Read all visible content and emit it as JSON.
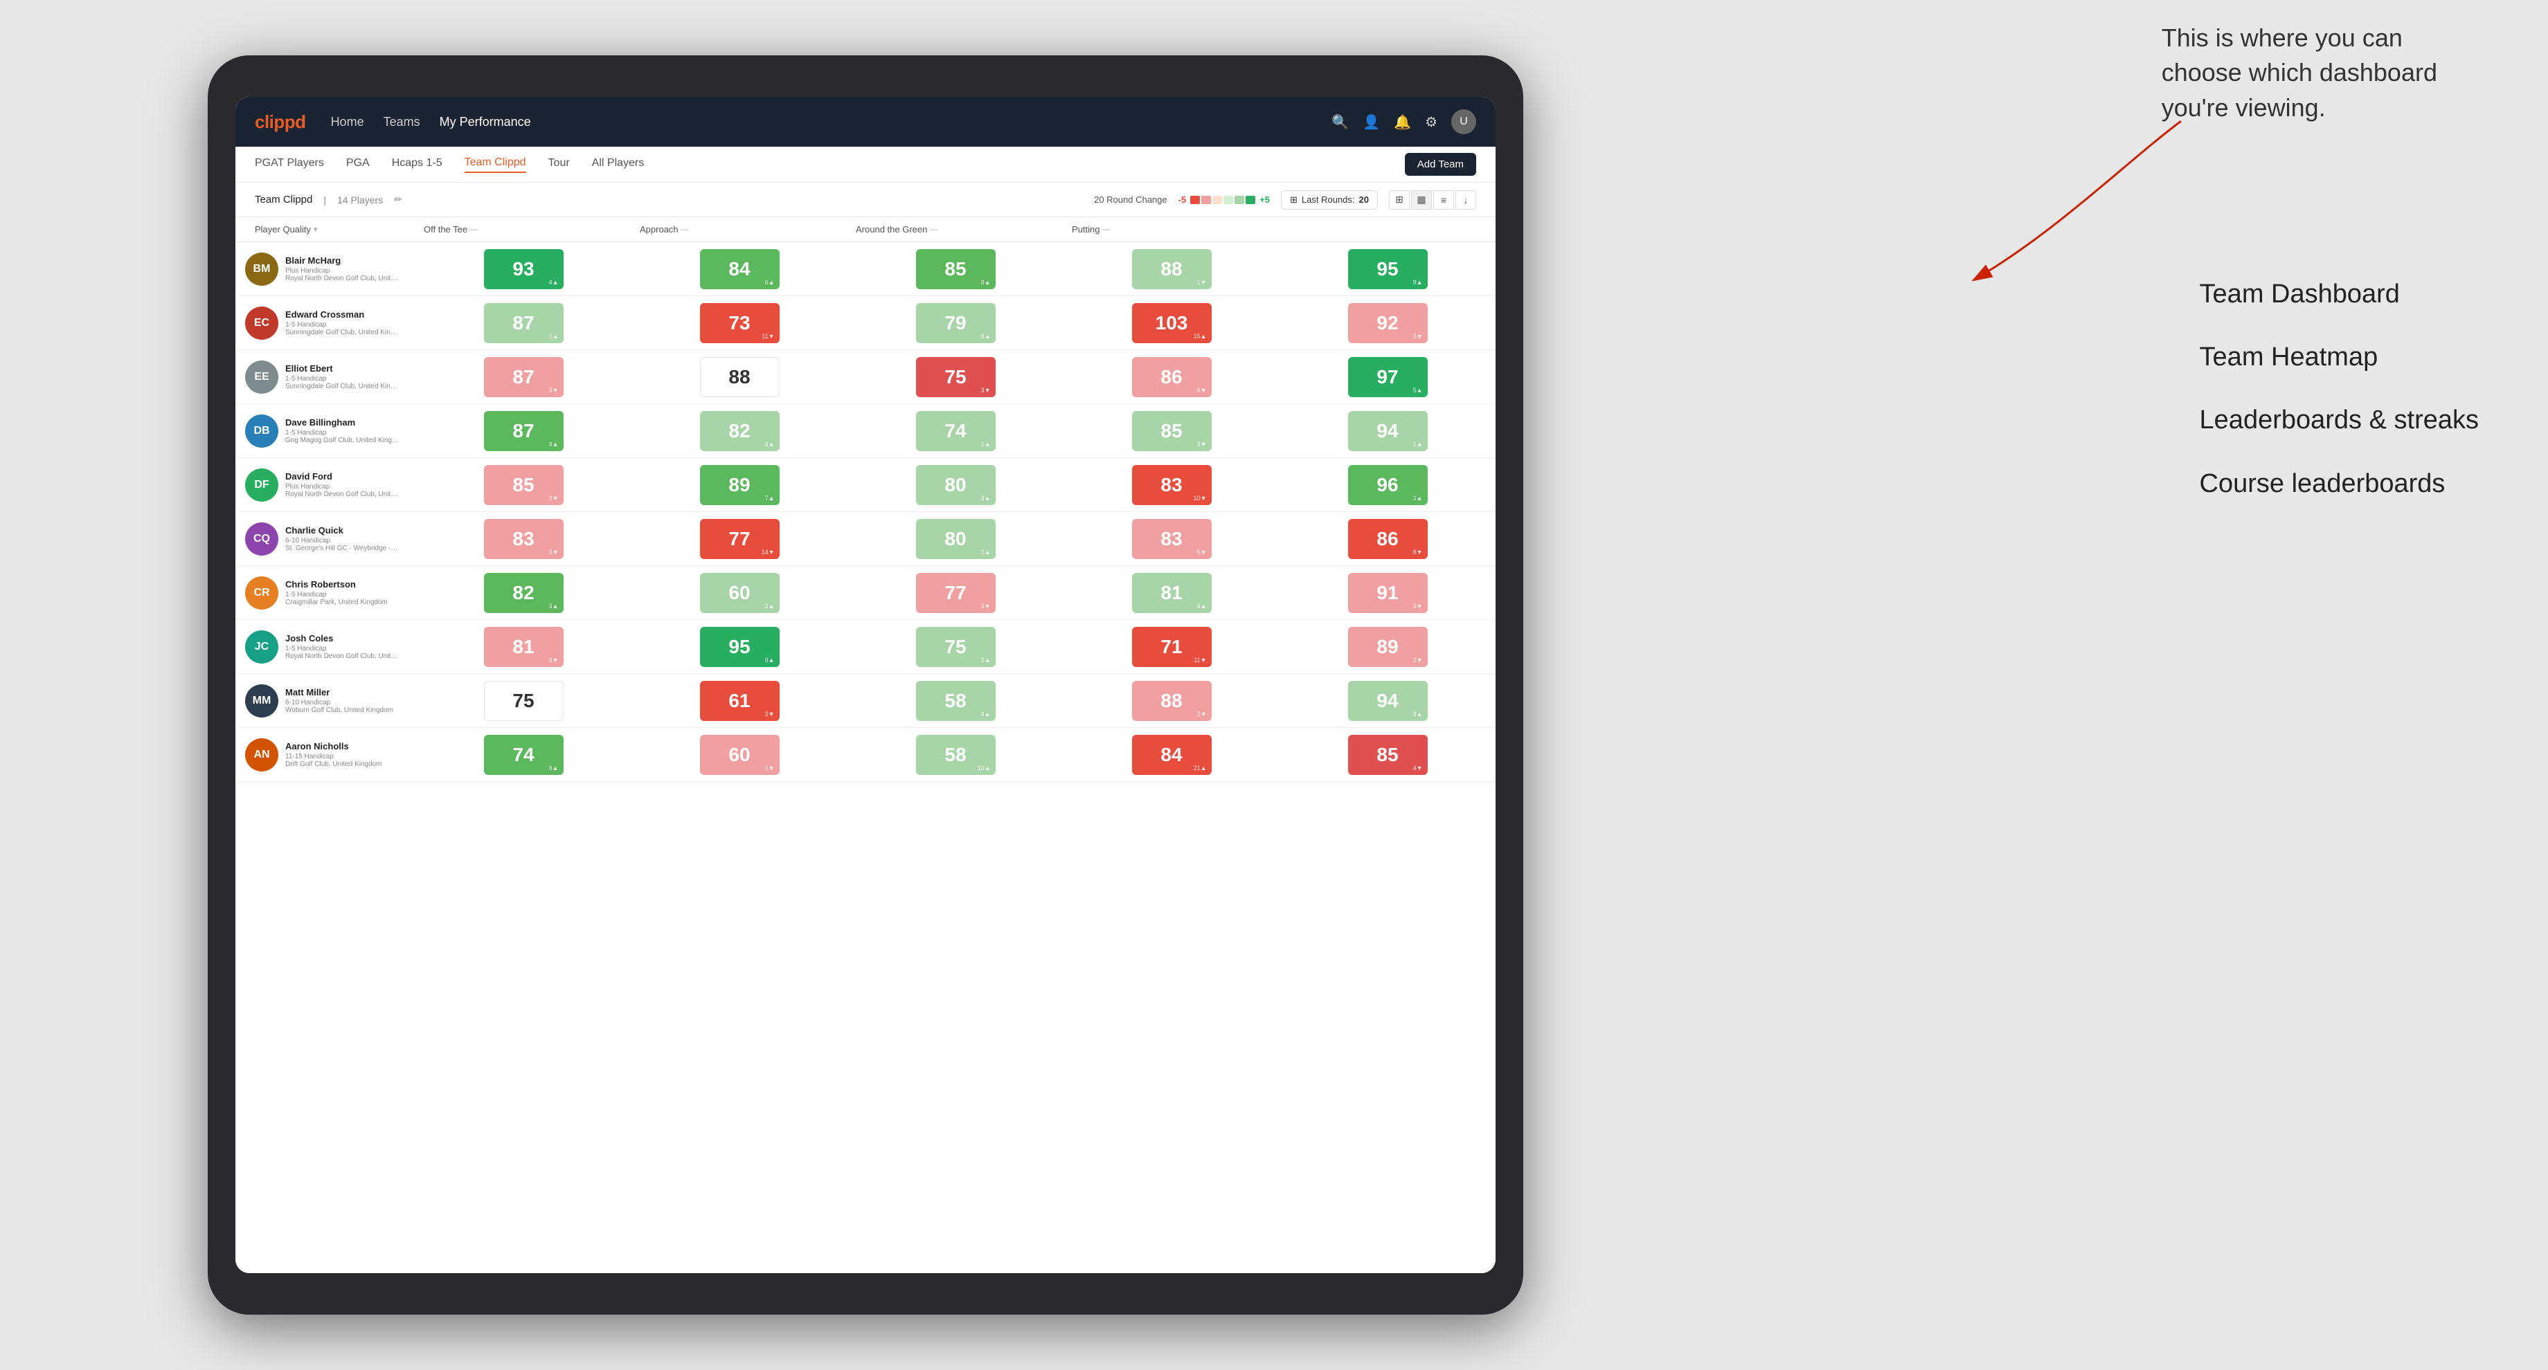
{
  "annotation": {
    "description": "This is where you can choose which dashboard you're viewing.",
    "labels": [
      "Team Dashboard",
      "Team Heatmap",
      "Leaderboards & streaks",
      "Course leaderboards"
    ]
  },
  "navbar": {
    "logo": "clippd",
    "links": [
      "Home",
      "Teams",
      "My Performance"
    ],
    "active_link": "My Performance"
  },
  "subnav": {
    "items": [
      "PGAT Players",
      "PGA",
      "Hcaps 1-5",
      "Team Clippd",
      "Tour",
      "All Players"
    ],
    "active": "Team Clippd",
    "add_team_label": "Add Team"
  },
  "toolbar": {
    "team_name": "Team Clippd",
    "player_count": "14 Players",
    "round_change_label": "20 Round Change",
    "neg_value": "-5",
    "pos_value": "+5",
    "last_rounds_label": "Last Rounds:",
    "last_rounds_count": "20"
  },
  "table": {
    "headers": [
      {
        "label": "Player Quality",
        "key": "player_quality",
        "sortable": true
      },
      {
        "label": "Off the Tee",
        "key": "off_tee",
        "sortable": true
      },
      {
        "label": "Approach",
        "key": "approach",
        "sortable": true
      },
      {
        "label": "Around the Green",
        "key": "around_green",
        "sortable": true
      },
      {
        "label": "Putting",
        "key": "putting",
        "sortable": true
      }
    ],
    "players": [
      {
        "name": "Blair McHarg",
        "handicap": "Plus Handicap",
        "club": "Royal North Devon Golf Club, United Kingdom",
        "avatar_initials": "BM",
        "avatar_color": "#8B6914",
        "metrics": {
          "player_quality": {
            "value": 93,
            "change": 4,
            "dir": "up",
            "color": "green-strong"
          },
          "off_tee": {
            "value": 84,
            "change": 6,
            "dir": "up",
            "color": "green-mid"
          },
          "approach": {
            "value": 85,
            "change": 8,
            "dir": "up",
            "color": "green-mid"
          },
          "around_green": {
            "value": 88,
            "change": 1,
            "dir": "down",
            "color": "green-light"
          },
          "putting": {
            "value": 95,
            "change": 9,
            "dir": "up",
            "color": "green-strong"
          }
        }
      },
      {
        "name": "Edward Crossman",
        "handicap": "1-5 Handicap",
        "club": "Sunningdale Golf Club, United Kingdom",
        "avatar_initials": "EC",
        "avatar_color": "#c0392b",
        "metrics": {
          "player_quality": {
            "value": 87,
            "change": 1,
            "dir": "up",
            "color": "green-light"
          },
          "off_tee": {
            "value": 73,
            "change": 11,
            "dir": "down",
            "color": "red-strong"
          },
          "approach": {
            "value": 79,
            "change": 9,
            "dir": "up",
            "color": "green-light"
          },
          "around_green": {
            "value": 103,
            "change": 15,
            "dir": "up",
            "color": "red-strong"
          },
          "putting": {
            "value": 92,
            "change": 3,
            "dir": "down",
            "color": "red-light"
          }
        }
      },
      {
        "name": "Elliot Ebert",
        "handicap": "1-5 Handicap",
        "club": "Sunningdale Golf Club, United Kingdom",
        "avatar_initials": "EE",
        "avatar_color": "#7f8c8d",
        "metrics": {
          "player_quality": {
            "value": 87,
            "change": 3,
            "dir": "down",
            "color": "red-light"
          },
          "off_tee": {
            "value": 88,
            "change": null,
            "dir": null,
            "color": "white"
          },
          "approach": {
            "value": 75,
            "change": 3,
            "dir": "down",
            "color": "red-mid"
          },
          "around_green": {
            "value": 86,
            "change": 6,
            "dir": "down",
            "color": "red-light"
          },
          "putting": {
            "value": 97,
            "change": 5,
            "dir": "up",
            "color": "green-strong"
          }
        }
      },
      {
        "name": "Dave Billingham",
        "handicap": "1-5 Handicap",
        "club": "Gog Magog Golf Club, United Kingdom",
        "avatar_initials": "DB",
        "avatar_color": "#2980b9",
        "metrics": {
          "player_quality": {
            "value": 87,
            "change": 4,
            "dir": "up",
            "color": "green-mid"
          },
          "off_tee": {
            "value": 82,
            "change": 4,
            "dir": "up",
            "color": "green-light"
          },
          "approach": {
            "value": 74,
            "change": 1,
            "dir": "up",
            "color": "green-light"
          },
          "around_green": {
            "value": 85,
            "change": 3,
            "dir": "down",
            "color": "green-light"
          },
          "putting": {
            "value": 94,
            "change": 1,
            "dir": "up",
            "color": "green-light"
          }
        }
      },
      {
        "name": "David Ford",
        "handicap": "Plus Handicap",
        "club": "Royal North Devon Golf Club, United Kingdom",
        "avatar_initials": "DF",
        "avatar_color": "#27ae60",
        "metrics": {
          "player_quality": {
            "value": 85,
            "change": 3,
            "dir": "down",
            "color": "red-light"
          },
          "off_tee": {
            "value": 89,
            "change": 7,
            "dir": "up",
            "color": "green-mid"
          },
          "approach": {
            "value": 80,
            "change": 3,
            "dir": "up",
            "color": "green-light"
          },
          "around_green": {
            "value": 83,
            "change": 10,
            "dir": "down",
            "color": "red-strong"
          },
          "putting": {
            "value": 96,
            "change": 3,
            "dir": "up",
            "color": "green-mid"
          }
        }
      },
      {
        "name": "Charlie Quick",
        "handicap": "6-10 Handicap",
        "club": "St. George's Hill GC - Weybridge - Surrey, Uni...",
        "avatar_initials": "CQ",
        "avatar_color": "#8e44ad",
        "metrics": {
          "player_quality": {
            "value": 83,
            "change": 3,
            "dir": "down",
            "color": "red-light"
          },
          "off_tee": {
            "value": 77,
            "change": 14,
            "dir": "down",
            "color": "red-strong"
          },
          "approach": {
            "value": 80,
            "change": 1,
            "dir": "up",
            "color": "green-light"
          },
          "around_green": {
            "value": 83,
            "change": 6,
            "dir": "down",
            "color": "red-light"
          },
          "putting": {
            "value": 86,
            "change": 8,
            "dir": "down",
            "color": "red-strong"
          }
        }
      },
      {
        "name": "Chris Robertson",
        "handicap": "1-5 Handicap",
        "club": "Craigmillar Park, United Kingdom",
        "avatar_initials": "CR",
        "avatar_color": "#e67e22",
        "metrics": {
          "player_quality": {
            "value": 82,
            "change": 3,
            "dir": "up",
            "color": "green-mid"
          },
          "off_tee": {
            "value": 60,
            "change": 2,
            "dir": "up",
            "color": "green-light"
          },
          "approach": {
            "value": 77,
            "change": 3,
            "dir": "down",
            "color": "red-light"
          },
          "around_green": {
            "value": 81,
            "change": 4,
            "dir": "up",
            "color": "green-light"
          },
          "putting": {
            "value": 91,
            "change": 3,
            "dir": "down",
            "color": "red-light"
          }
        }
      },
      {
        "name": "Josh Coles",
        "handicap": "1-5 Handicap",
        "club": "Royal North Devon Golf Club, United Kingdom",
        "avatar_initials": "JC",
        "avatar_color": "#16a085",
        "metrics": {
          "player_quality": {
            "value": 81,
            "change": 3,
            "dir": "down",
            "color": "red-light"
          },
          "off_tee": {
            "value": 95,
            "change": 8,
            "dir": "up",
            "color": "green-strong"
          },
          "approach": {
            "value": 75,
            "change": 2,
            "dir": "up",
            "color": "green-light"
          },
          "around_green": {
            "value": 71,
            "change": 11,
            "dir": "down",
            "color": "red-strong"
          },
          "putting": {
            "value": 89,
            "change": 2,
            "dir": "down",
            "color": "red-light"
          }
        }
      },
      {
        "name": "Matt Miller",
        "handicap": "6-10 Handicap",
        "club": "Woburn Golf Club, United Kingdom",
        "avatar_initials": "MM",
        "avatar_color": "#2c3e50",
        "metrics": {
          "player_quality": {
            "value": 75,
            "change": null,
            "dir": null,
            "color": "white"
          },
          "off_tee": {
            "value": 61,
            "change": 3,
            "dir": "down",
            "color": "red-strong"
          },
          "approach": {
            "value": 58,
            "change": 4,
            "dir": "up",
            "color": "green-light"
          },
          "around_green": {
            "value": 88,
            "change": 2,
            "dir": "down",
            "color": "red-light"
          },
          "putting": {
            "value": 94,
            "change": 3,
            "dir": "up",
            "color": "green-light"
          }
        }
      },
      {
        "name": "Aaron Nicholls",
        "handicap": "11-15 Handicap",
        "club": "Drift Golf Club, United Kingdom",
        "avatar_initials": "AN",
        "avatar_color": "#d35400",
        "metrics": {
          "player_quality": {
            "value": 74,
            "change": 8,
            "dir": "up",
            "color": "green-mid"
          },
          "off_tee": {
            "value": 60,
            "change": 1,
            "dir": "down",
            "color": "red-light"
          },
          "approach": {
            "value": 58,
            "change": 10,
            "dir": "up",
            "color": "green-light"
          },
          "around_green": {
            "value": 84,
            "change": 21,
            "dir": "up",
            "color": "red-strong"
          },
          "putting": {
            "value": 85,
            "change": 4,
            "dir": "down",
            "color": "red-mid"
          }
        }
      }
    ]
  }
}
